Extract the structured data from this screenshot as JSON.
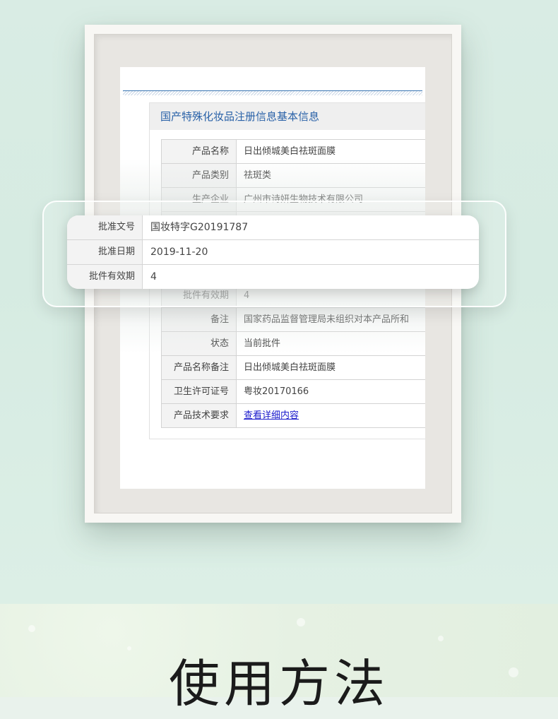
{
  "document": {
    "title": "国产特殊化妆品注册信息基本信息",
    "rows": [
      {
        "label": "产品名称",
        "value": "日出倾城美白祛斑面膜"
      },
      {
        "label": "产品类别",
        "value": "祛斑类"
      },
      {
        "label": "生产企业",
        "value": "广州市诗妍生物技术有限公司"
      },
      {
        "label": "",
        "value": ""
      },
      {
        "label": "",
        "value": ""
      },
      {
        "label": "",
        "value": ""
      },
      {
        "label": "批件有效期",
        "value": "4"
      },
      {
        "label": "备注",
        "value": "国家药品监督管理局未组织对本产品所和"
      },
      {
        "label": "状态",
        "value": "当前批件"
      },
      {
        "label": "产品名称备注",
        "value": "日出倾城美白祛斑面膜"
      },
      {
        "label": "卫生许可证号",
        "value": "粤妆20170166"
      },
      {
        "label": "产品技术要求",
        "value": "查看详细内容"
      }
    ]
  },
  "magnified": {
    "rows": [
      {
        "label": "批准文号",
        "value": "国妆特字G20191787"
      },
      {
        "label": "批准日期",
        "value": "2019-11-20"
      },
      {
        "label": "批件有效期",
        "value": "4"
      }
    ]
  },
  "section_heading": "使用方法"
}
